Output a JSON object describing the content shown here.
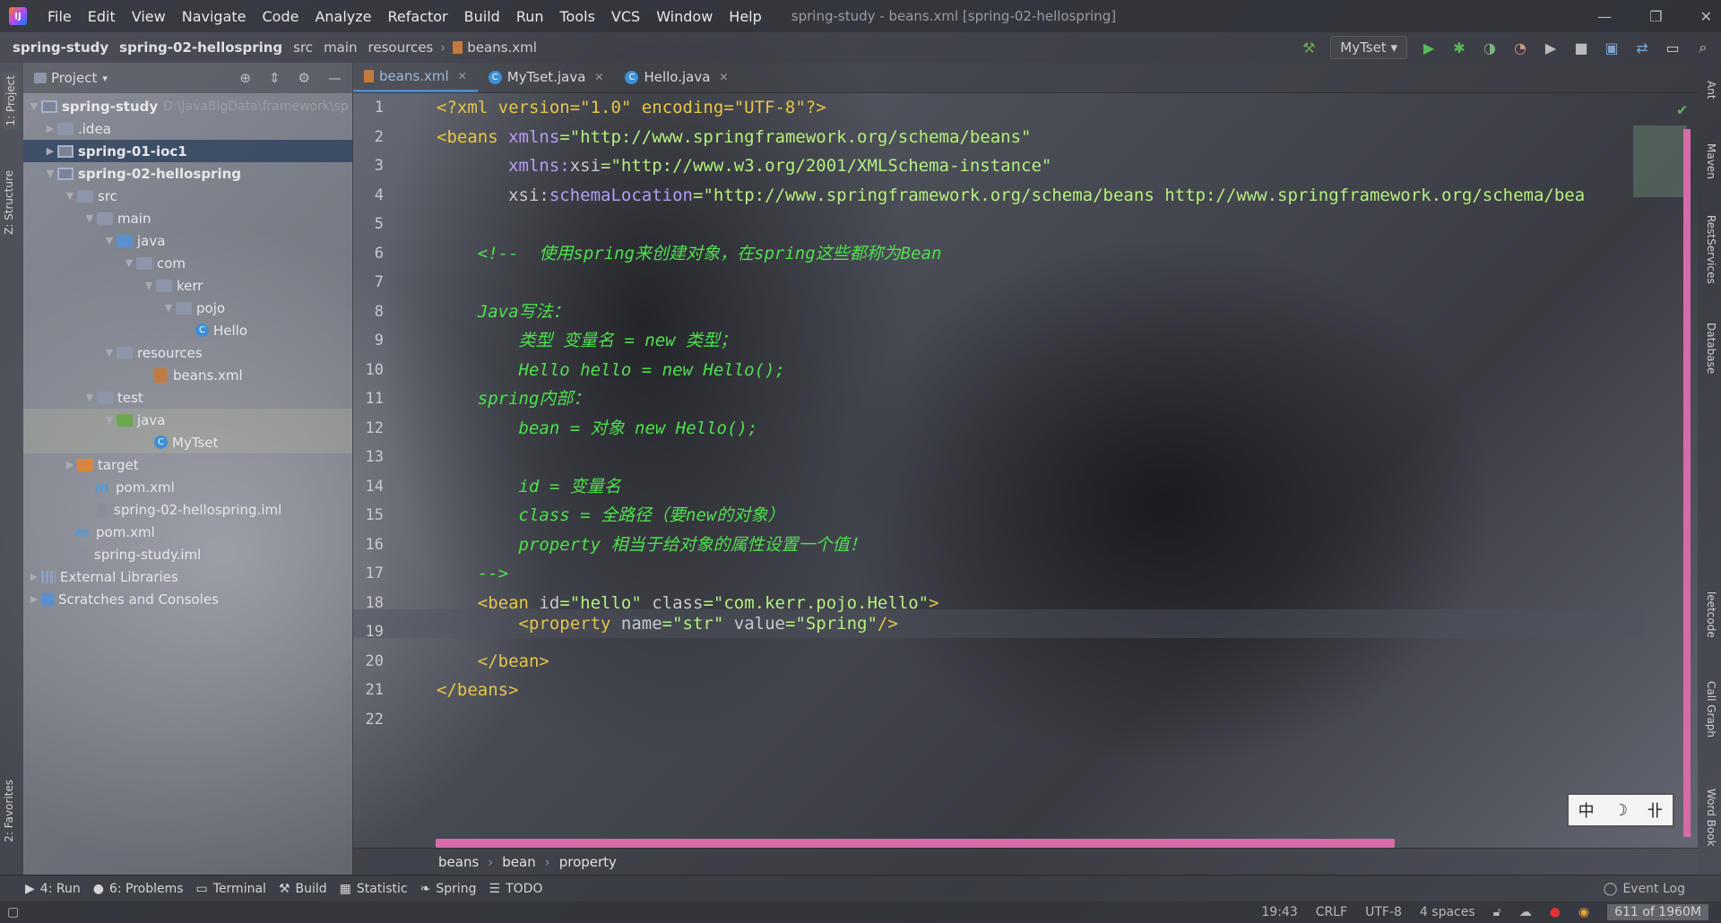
{
  "menubar": {
    "items": [
      "File",
      "Edit",
      "View",
      "Navigate",
      "Code",
      "Analyze",
      "Refactor",
      "Build",
      "Run",
      "Tools",
      "VCS",
      "Window",
      "Help"
    ],
    "title": "spring-study - beans.xml [spring-02-hellospring]"
  },
  "navbar": {
    "crumbs": [
      "spring-study",
      "spring-02-hellospring",
      "src",
      "main",
      "resources",
      "beans.xml"
    ],
    "run_config": "MyTset"
  },
  "left_stripe": {
    "project": "1: Project",
    "structure": "Z: Structure",
    "favorites": "2: Favorites"
  },
  "project": {
    "header": "Project",
    "tree": [
      {
        "label": "spring-study",
        "extra": "D:\\JavaBigData\\framework\\sp"
      },
      {
        "label": ".idea"
      },
      {
        "label": "spring-01-ioc1"
      },
      {
        "label": "spring-02-hellospring"
      },
      {
        "label": "src"
      },
      {
        "label": "main"
      },
      {
        "label": "java"
      },
      {
        "label": "com"
      },
      {
        "label": "kerr"
      },
      {
        "label": "pojo"
      },
      {
        "label": "Hello"
      },
      {
        "label": "resources"
      },
      {
        "label": "beans.xml"
      },
      {
        "label": "test"
      },
      {
        "label": "java"
      },
      {
        "label": "MyTset"
      },
      {
        "label": "target"
      },
      {
        "label": "pom.xml"
      },
      {
        "label": "spring-02-hellospring.iml"
      },
      {
        "label": "pom.xml"
      },
      {
        "label": "spring-study.iml"
      },
      {
        "label": "External Libraries"
      },
      {
        "label": "Scratches and Consoles"
      }
    ]
  },
  "editor": {
    "tabs": [
      "beans.xml",
      "MyTset.java",
      "Hello.java"
    ],
    "line_numbers": [
      "1",
      "2",
      "3",
      "4",
      "5",
      "6",
      "7",
      "8",
      "9",
      "10",
      "11",
      "12",
      "13",
      "14",
      "15",
      "16",
      "17",
      "18",
      "19",
      "20",
      "21",
      "22"
    ],
    "code": {
      "l1": "<?xml version=\"1.0\" encoding=\"UTF-8\"?>",
      "l2a": "<beans ",
      "l2b": "xmlns",
      "l2c": "=\"http://www.springframework.org/schema/beans\"",
      "l3a": "       xmlns:",
      "l3b": "xsi",
      "l3c": "=\"http://www.w3.org/2001/XMLSchema-instance\"",
      "l4a": "       xsi:",
      "l4b": "schemaLocation",
      "l4c": "=\"http://www.springframework.org/schema/beans http://www.springframework.org/schema/bea",
      "l6": "    <!--  使用spring来创建对象，在spring这些都称为Bean",
      "l8": "    Java写法：",
      "l9": "        类型 变量名 = new 类型；",
      "l10": "        Hello hello = new Hello();",
      "l11": "    spring内部：",
      "l12": "        bean = 对象 new Hello();",
      "l14": "        id = 变量名",
      "l15": "        class = 全路径（要new的对象）",
      "l16": "        property 相当于给对象的属性设置一个值！",
      "l17": "    -->",
      "l18a": "    <bean ",
      "l18b": "id",
      "l18c": "=\"hello\" ",
      "l18d": "class",
      "l18e": "=\"com.kerr.pojo.Hello\"",
      "l18f": ">",
      "l19a": "        <property ",
      "l19b": "name",
      "l19c": "=\"str\" ",
      "l19d": "value",
      "l19e": "=\"Spring\"",
      "l19f": "/>",
      "l20": "    </bean>",
      "l21": "</beans>"
    },
    "breadcrumb": [
      "beans",
      "bean",
      "property"
    ]
  },
  "right_stripe": [
    "Ant",
    "Maven",
    "RestServices",
    "Database",
    "leetcode",
    "Call Graph",
    "Word Book"
  ],
  "ime": {
    "a": "中",
    "b": "☽",
    "c": "卝"
  },
  "toolwindows": {
    "run": "4: Run",
    "problems": "6: Problems",
    "terminal": "Terminal",
    "build": "Build",
    "statistic": "Statistic",
    "spring": "Spring",
    "todo": "TODO",
    "event_log": "Event Log"
  },
  "status": {
    "position": "19:43",
    "line_sep": "CRLF",
    "encoding": "UTF-8",
    "indent": "4 spaces",
    "memory": "611 of 1960M"
  }
}
